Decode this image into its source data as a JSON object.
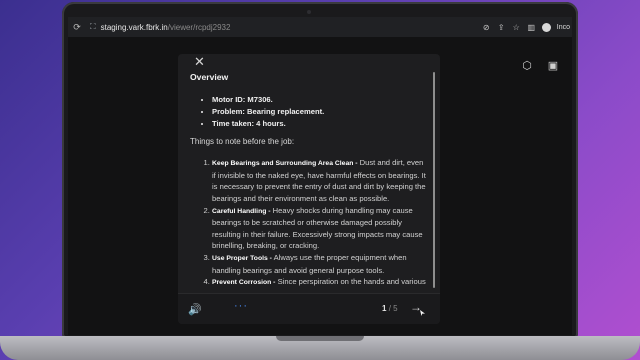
{
  "browser": {
    "url_host": "staging.vark.fbrk.in",
    "url_path": "/viewer/rcpdj2932",
    "profile_label": "Inco"
  },
  "modal": {
    "heading": "Overview",
    "bullets": [
      "Motor ID: M7306.",
      "Problem: Bearing replacement.",
      "Time taken: 4 hours."
    ],
    "intro": "Things to note before the job:",
    "notes": [
      {
        "title": "Keep Bearings and Surrounding Area Clean -",
        "text": " Dust and dirt, even if invisible to the naked eye, have harmful effects on bearings. It is necessary to prevent the entry of dust and dirt by keeping the bearings and their environment as clean as possible."
      },
      {
        "title": "Careful Handling -",
        "text": " Heavy shocks during handling may cause bearings to be scratched or otherwise damaged possibly resulting in their failure. Excessively strong impacts may cause brinelling, breaking, or cracking."
      },
      {
        "title": "Use Proper Tools -",
        "text": " Always use the proper equipment when handling bearings and avoid general purpose tools."
      },
      {
        "title": "Prevent Corrosion -",
        "text": " Since perspiration on the hands and various"
      }
    ],
    "footer": {
      "current_page": "1",
      "separator": "/",
      "total_pages": "5"
    }
  },
  "icons": {
    "close": "close-icon",
    "speaker": "speaker-icon",
    "more": "more-icon",
    "next": "next-arrow-icon"
  }
}
